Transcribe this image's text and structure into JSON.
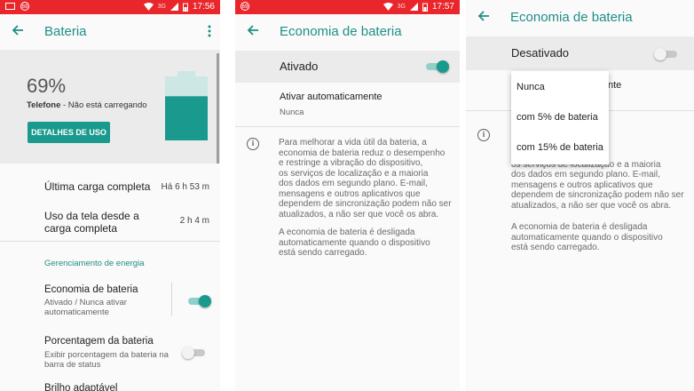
{
  "status": {
    "time_1": "17:56",
    "time_2": "17:57",
    "network": "3G",
    "notif_badge": "69"
  },
  "panel1": {
    "title": "Bateria",
    "percent": "69%",
    "state_bold": "Telefone",
    "state_rest": " - Não está carregando",
    "details_button": "DETALHES DE USO",
    "battery_level": 0.69,
    "last_charge_label": "Última carga completa",
    "last_charge_value": "Há 6 h 53 m",
    "screen_use_line1": "Uso da tela desde a",
    "screen_use_line2": "carga completa",
    "screen_use_value": "2 h 4 m",
    "section_header": "Gerenciamento de energia",
    "saver_title": "Economia de bateria",
    "saver_sub_1": "Ativado / Nunca ativar",
    "saver_sub_2": "automaticamente",
    "percent_title": "Porcentagem da bateria",
    "percent_sub_1": "Exibir porcentagem da bateria na",
    "percent_sub_2": "barra de status",
    "adaptive_partial": "Brilho adaptável"
  },
  "panel2": {
    "title": "Economia de bateria",
    "master_label": "Ativado",
    "auto_title": "Ativar automaticamente",
    "auto_value": "Nunca",
    "info_text": "Para melhorar a vida útil da bateria, a\neconomia de bateria reduz o desempenho\ne restringe a vibração do dispositivo,\nos serviços de localização e a maioria\ndos dados em segundo plano. E-mail,\nmensagens e outros aplicativos que\ndependem de sincronização podem não ser\natualizados, a não ser que você os abra.",
    "info_text_2": "A economia de bateria é desligada\nautomaticamente quando o dispositivo\nestá sendo carregado."
  },
  "panel3": {
    "title": "Economia de bateria",
    "master_label": "Desativado",
    "behind_fragment": "nte",
    "info_visible": "da bateria, a\nreduz o desempenho\ndo dispositivo,\nos serviços de localização e a maioria\ndos dados em segundo plano. E-mail,\nmensagens e outros aplicativos que\ndependem de sincronização podem não ser\natualizados, a não ser que você os abra.",
    "info_text_2": "A economia de bateria é desligada\nautomaticamente quando o dispositivo\nestá sendo carregado.",
    "dropdown": [
      "Nunca",
      "com 5% de bateria",
      "com 15% de bateria"
    ]
  },
  "colors": {
    "accent": "#1f8f85",
    "statusbar": "#e8262b",
    "battery": "#1a9a8e"
  }
}
